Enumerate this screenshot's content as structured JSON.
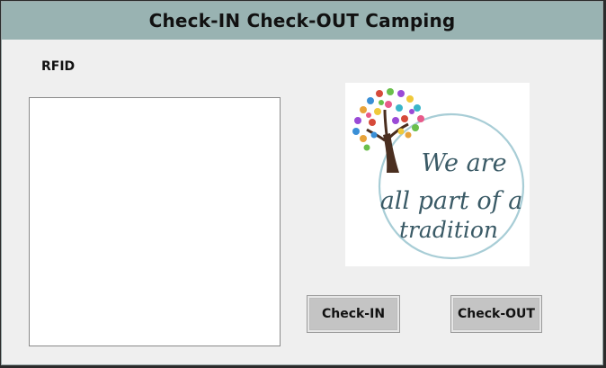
{
  "window": {
    "title": "Check-IN Check-OUT Camping"
  },
  "form": {
    "rfid_label": "RFID",
    "rfid_value": ""
  },
  "logo": {
    "text_line1": "We are",
    "text_line2": "all part of a",
    "text_line3": "tradition",
    "trunk_color": "#4a2e1f",
    "ring_color": "#a8cdd6",
    "text_color": "#3a5a66"
  },
  "buttons": {
    "check_in": "Check-IN",
    "check_out": "Check-OUT"
  },
  "colors": {
    "titlebar": "#99b3b2",
    "background": "#efefef",
    "button": "#c4c4c4"
  }
}
